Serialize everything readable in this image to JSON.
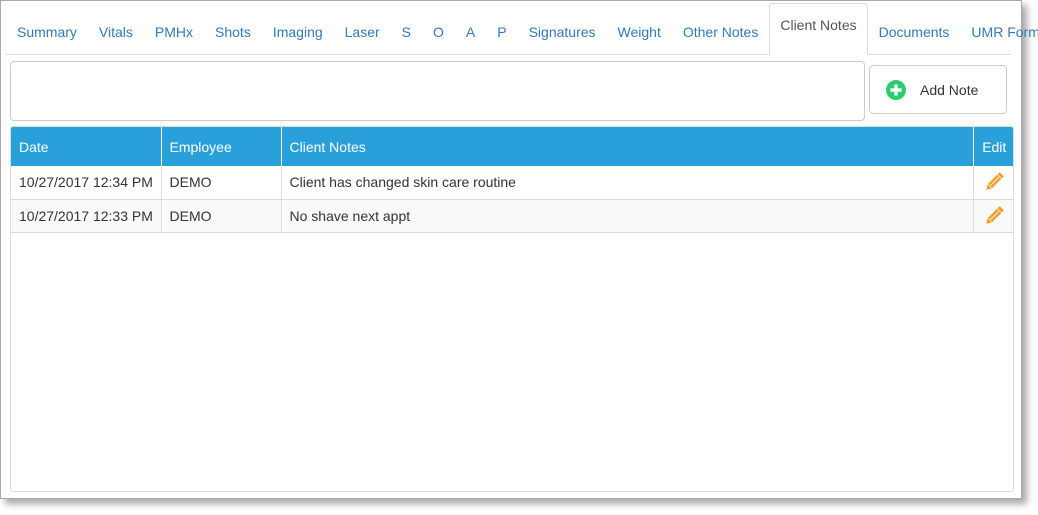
{
  "tabs": [
    {
      "label": "Summary",
      "active": false
    },
    {
      "label": "Vitals",
      "active": false
    },
    {
      "label": "PMHx",
      "active": false
    },
    {
      "label": "Shots",
      "active": false
    },
    {
      "label": "Imaging",
      "active": false
    },
    {
      "label": "Laser",
      "active": false
    },
    {
      "label": "S",
      "active": false
    },
    {
      "label": "O",
      "active": false
    },
    {
      "label": "A",
      "active": false
    },
    {
      "label": "P",
      "active": false
    },
    {
      "label": "Signatures",
      "active": false
    },
    {
      "label": "Weight",
      "active": false
    },
    {
      "label": "Other Notes",
      "active": false
    },
    {
      "label": "Client Notes",
      "active": true
    },
    {
      "label": "Documents",
      "active": false
    },
    {
      "label": "UMR Forms",
      "active": false
    }
  ],
  "note_input": {
    "value": "",
    "placeholder": ""
  },
  "add_note": {
    "label": "Add Note",
    "icon": "plus-circle-icon",
    "icon_color": "#2ecc71"
  },
  "table": {
    "header_color": "#29a0d9",
    "columns": [
      "Date",
      "Employee",
      "Client Notes",
      "Edit"
    ],
    "rows": [
      {
        "date": "10/27/2017 12:34 PM",
        "employee": "DEMO",
        "note": "Client has changed skin care routine",
        "edit_icon": "pencil-icon"
      },
      {
        "date": "10/27/2017 12:33 PM",
        "employee": "DEMO",
        "note": "No shave next appt",
        "edit_icon": "pencil-icon"
      }
    ],
    "edit_icon_color": "#f0a030"
  }
}
